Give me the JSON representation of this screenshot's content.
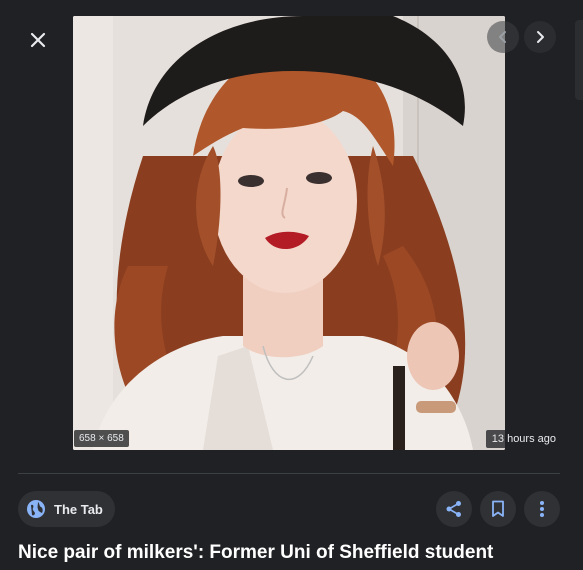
{
  "toolbar": {
    "close_icon": "close-icon",
    "prev_icon": "chevron-left-icon",
    "next_icon": "chevron-right-icon"
  },
  "image": {
    "dimensions": "658 × 658",
    "timestamp": "13 hours ago"
  },
  "source": {
    "name": "The Tab",
    "icon": "globe-icon"
  },
  "actions": {
    "share_icon": "share-icon",
    "save_icon": "bookmark-icon",
    "more_icon": "more-vert-icon"
  },
  "caption": "Nice pair of milkers': Former Uni of Sheffield student",
  "colors": {
    "background": "#202124",
    "accent": "#8ab4f8",
    "chip": "#303134"
  }
}
